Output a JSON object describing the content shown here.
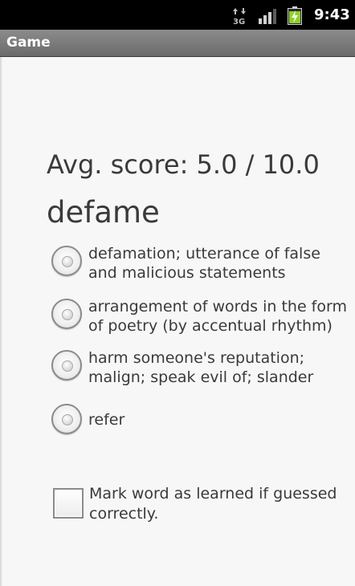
{
  "status_bar": {
    "network_type": "3G",
    "time": "9:43",
    "icons": [
      "data-arrows-3g-icon",
      "signal-strength-icon",
      "battery-charging-icon"
    ],
    "battery_color": "#8ed02a"
  },
  "title_bar": {
    "title": "Game"
  },
  "score": {
    "text": "Avg. score: 5.0 / 10.0"
  },
  "quiz": {
    "word": "defame",
    "options": [
      {
        "label": "defamation; utterance of false and malicious statements",
        "selected": false
      },
      {
        "label": "arrangement of words in the form of poetry (by accentual rhythm)",
        "selected": false
      },
      {
        "label": "harm someone's reputation; malign; speak evil of; slander",
        "selected": false
      },
      {
        "label": "refer",
        "selected": false
      }
    ]
  },
  "learned_checkbox": {
    "label": "Mark word as learned if guessed correctly.",
    "checked": false
  }
}
